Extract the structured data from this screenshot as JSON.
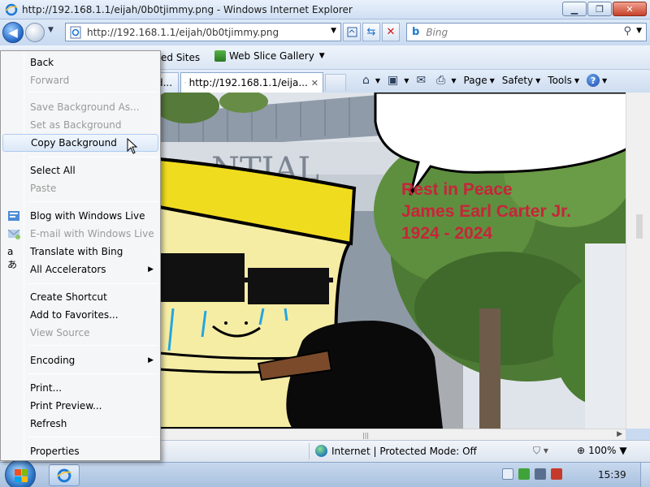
{
  "window": {
    "title": "http://192.168.1.1/eijah/0b0tjimmy.png - Windows Internet Explorer",
    "controls": {
      "minimize": "▁",
      "maximize": "❐",
      "close": "✕"
    }
  },
  "address_bar": {
    "url": "http://192.168.1.1/eijah/0b0tjimmy.png"
  },
  "search": {
    "placeholder": "Bing",
    "provider_icon": "b"
  },
  "favorites_bar": {
    "suggested_sites": "ed Sites",
    "web_slice_gallery": "Web Slice Gallery"
  },
  "tabs": [
    {
      "label": "d..."
    },
    {
      "label": "http://192.168.1.1/eija..."
    }
  ],
  "command_bar": {
    "page": "Page",
    "safety": "Safety",
    "tools": "Tools"
  },
  "image": {
    "bubble_line1": "Rest in Peace",
    "bubble_line2": "James Earl Carter Jr.",
    "bubble_line3": "1924 - 2024",
    "building_text": "NTIAL"
  },
  "context_menu": {
    "items": [
      {
        "label": "Back",
        "enabled": true
      },
      {
        "label": "Forward",
        "enabled": false
      },
      {
        "label": "Save Background As...",
        "enabled": false
      },
      {
        "label": "Set as Background",
        "enabled": false
      },
      {
        "label": "Copy Background",
        "enabled": true,
        "highlighted": true
      },
      {
        "label": "Select All",
        "enabled": true
      },
      {
        "label": "Paste",
        "enabled": false
      },
      {
        "label": "Blog with Windows Live",
        "enabled": true
      },
      {
        "label": "E-mail with Windows Live",
        "enabled": false
      },
      {
        "label": "Translate with Bing",
        "enabled": true
      },
      {
        "label": "All Accelerators",
        "enabled": true,
        "submenu": true
      },
      {
        "label": "Create Shortcut",
        "enabled": true
      },
      {
        "label": "Add to Favorites...",
        "enabled": true
      },
      {
        "label": "View Source",
        "enabled": false
      },
      {
        "label": "Encoding",
        "enabled": true,
        "submenu": true
      },
      {
        "label": "Print...",
        "enabled": true
      },
      {
        "label": "Print Preview...",
        "enabled": true
      },
      {
        "label": "Refresh",
        "enabled": true
      },
      {
        "label": "Properties",
        "enabled": true
      }
    ]
  },
  "status_bar": {
    "zone": "Internet | Protected Mode: Off",
    "zoom": "100%"
  },
  "taskbar": {
    "clock": "15:39"
  }
}
